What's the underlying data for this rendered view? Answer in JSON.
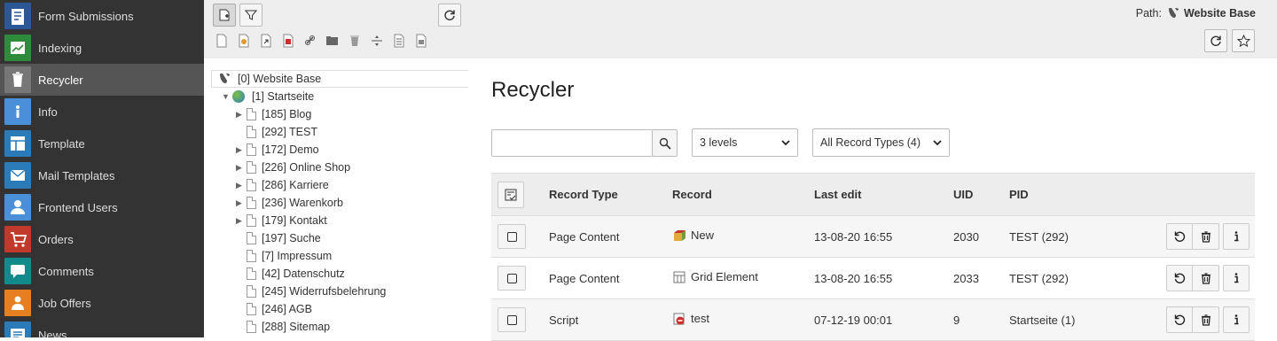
{
  "modules": [
    {
      "label": "Form Submissions",
      "icon": "form-submissions-icon",
      "color": "#2b5797",
      "active": false
    },
    {
      "label": "Indexing",
      "icon": "indexing-icon",
      "color": "#2e8b3a",
      "active": false
    },
    {
      "label": "Recycler",
      "icon": "trash-icon",
      "color": "#777777",
      "active": true
    },
    {
      "label": "Info",
      "icon": "info-icon",
      "color": "#4a90d9",
      "active": false
    },
    {
      "label": "Template",
      "icon": "template-icon",
      "color": "#2b7bb9",
      "active": false
    },
    {
      "label": "Mail Templates",
      "icon": "mail-icon",
      "color": "#2b7bb9",
      "active": false
    },
    {
      "label": "Frontend Users",
      "icon": "user-icon",
      "color": "#4a90d9",
      "active": false
    },
    {
      "label": "Orders",
      "icon": "cart-icon",
      "color": "#c0392b",
      "active": false
    },
    {
      "label": "Comments",
      "icon": "comments-icon",
      "color": "#138a8a",
      "active": false
    },
    {
      "label": "Job Offers",
      "icon": "job-icon",
      "color": "#e67e22",
      "active": false
    },
    {
      "label": "News",
      "icon": "news-icon",
      "color": "#2b7bb9",
      "active": false
    }
  ],
  "path": {
    "label": "Path:",
    "value": "Website Base"
  },
  "tree": {
    "root": "[0] Website Base",
    "start": "[1] Startseite",
    "pages": [
      {
        "label": "[185] Blog",
        "expandable": true
      },
      {
        "label": "[292] TEST",
        "expandable": false
      },
      {
        "label": "[172] Demo",
        "expandable": true
      },
      {
        "label": "[226] Online Shop",
        "expandable": true
      },
      {
        "label": "[286] Karriere",
        "expandable": true
      },
      {
        "label": "[236] Warenkorb",
        "expandable": true
      },
      {
        "label": "[179] Kontakt",
        "expandable": true
      },
      {
        "label": "[197] Suche",
        "expandable": false
      },
      {
        "label": "[7] Impressum",
        "expandable": false
      },
      {
        "label": "[42] Datenschutz",
        "expandable": false
      },
      {
        "label": "[245] Widerrufsbelehrung",
        "expandable": false
      },
      {
        "label": "[246] AGB",
        "expandable": false
      },
      {
        "label": "[288] Sitemap",
        "expandable": false
      }
    ]
  },
  "recycler": {
    "title": "Recycler",
    "search_placeholder": "",
    "depth_selected": "3 levels",
    "type_selected": "All Record Types (4)",
    "columns": [
      "Record Type",
      "Record",
      "Last edit",
      "UID",
      "PID"
    ],
    "rows": [
      {
        "type": "Page Content",
        "record": "New",
        "record_icon": "content-icon",
        "last_edit": "13-08-20 16:55",
        "uid": "2030",
        "pid": "TEST (292)"
      },
      {
        "type": "Page Content",
        "record": "Grid Element",
        "record_icon": "grid-icon",
        "last_edit": "13-08-20 16:55",
        "uid": "2033",
        "pid": "TEST (292)"
      },
      {
        "type": "Script",
        "record": "test",
        "record_icon": "script-icon",
        "last_edit": "07-12-19 00:01",
        "uid": "9",
        "pid": "Startseite (1)"
      }
    ]
  }
}
